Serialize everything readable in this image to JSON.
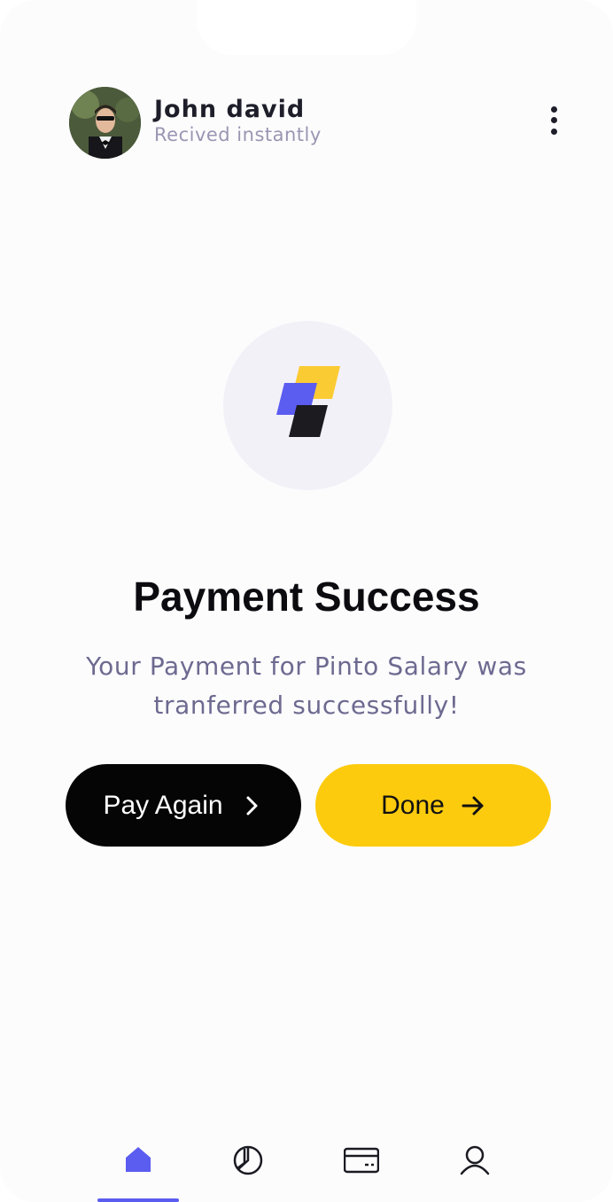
{
  "header": {
    "user_name": "John david",
    "user_status": "Recived instantly",
    "avatar_icon": "user-avatar-photo",
    "menu_icon": "more-vertical-icon"
  },
  "hero": {
    "logo_icon": "brand-logo-icon",
    "title": "Payment Success",
    "description": "Your Payment for Pinto Salary was tranferred successfully!"
  },
  "actions": {
    "pay_again_label": "Pay Again",
    "done_label": "Done"
  },
  "nav": {
    "items": [
      {
        "icon": "home-icon",
        "active": true
      },
      {
        "icon": "pie-chart-icon",
        "active": false
      },
      {
        "icon": "credit-card-icon",
        "active": false
      },
      {
        "icon": "user-icon",
        "active": false
      }
    ]
  },
  "colors": {
    "accent": "#5b5cf0",
    "brand_yellow": "#fdcb0d",
    "primary_dark": "#050505",
    "muted_text": "#6d6a90"
  }
}
